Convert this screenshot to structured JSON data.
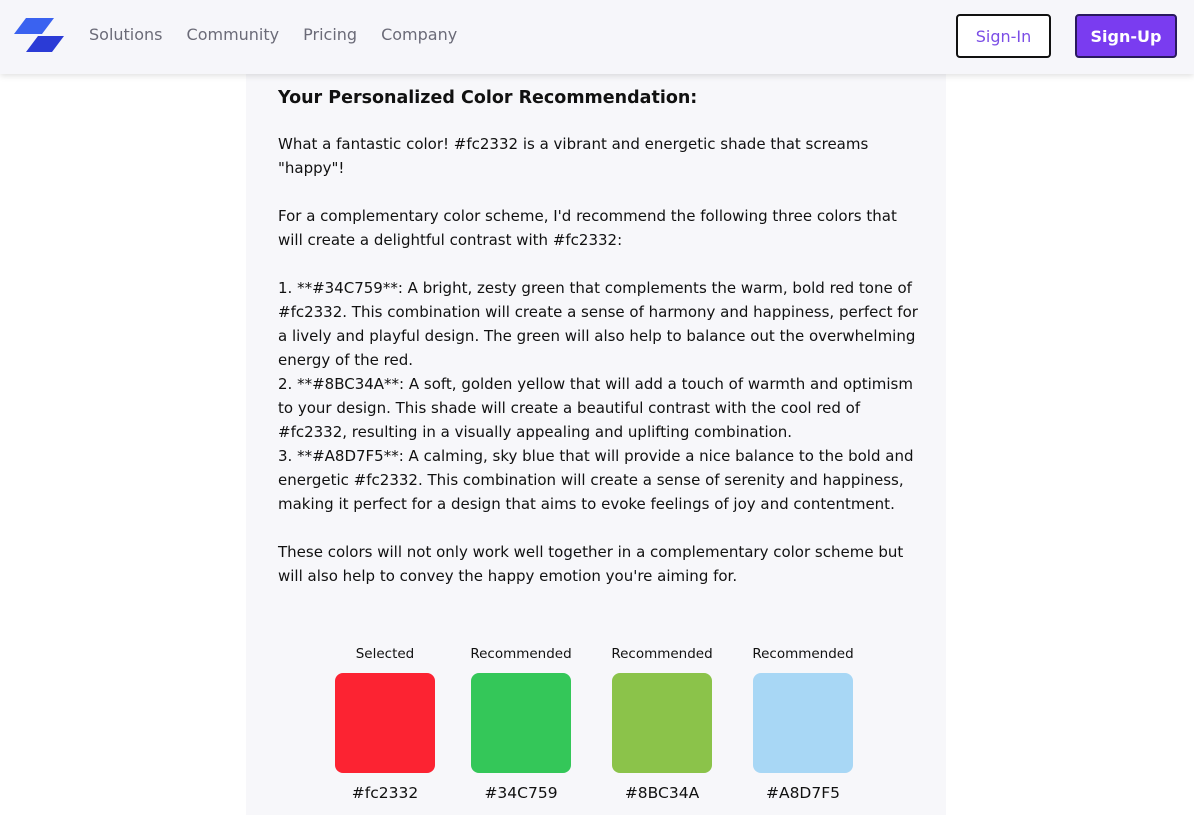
{
  "nav": {
    "links": [
      "Solutions",
      "Community",
      "Pricing",
      "Company"
    ],
    "signin_label": "Sign-In",
    "signup_label": "Sign-Up"
  },
  "recommendation": {
    "title": "Your Personalized Color Recommendation:",
    "intro": "What a fantastic color! #fc2332 is a vibrant and energetic shade that screams \"happy\"!",
    "lead": "For a complementary color scheme, I'd recommend the following three colors that will create a delightful contrast with #fc2332:",
    "items": [
      "1. **#34C759**: A bright, zesty green that complements the warm, bold red tone of #fc2332. This combination will create a sense of harmony and happiness, perfect for a lively and playful design. The green will also help to balance out the overwhelming energy of the red.",
      "2. **#8BC34A**: A soft, golden yellow that will add a touch of warmth and optimism to your design. This shade will create a beautiful contrast with the cool red of #fc2332, resulting in a visually appealing and uplifting combination.",
      "3. **#A8D7F5**: A calming, sky blue that will provide a nice balance to the bold and energetic #fc2332. This combination will create a sense of serenity and happiness, making it perfect for a design that aims to evoke feelings of joy and contentment."
    ],
    "closing": "These colors will not only work well together in a complementary color scheme but will also help to convey the happy emotion you're aiming for."
  },
  "swatches": [
    {
      "label": "Selected",
      "hex": "#fc2332",
      "color": "#fc2332"
    },
    {
      "label": "Recommended",
      "hex": "#34C759",
      "color": "#34C759"
    },
    {
      "label": "Recommended",
      "hex": "#8BC34A",
      "color": "#8BC34A"
    },
    {
      "label": "Recommended",
      "hex": "#A8D7F5",
      "color": "#A8D7F5"
    }
  ],
  "theme": {
    "accent": "#7a3cf0",
    "logo_color": "#2b3bd6"
  }
}
